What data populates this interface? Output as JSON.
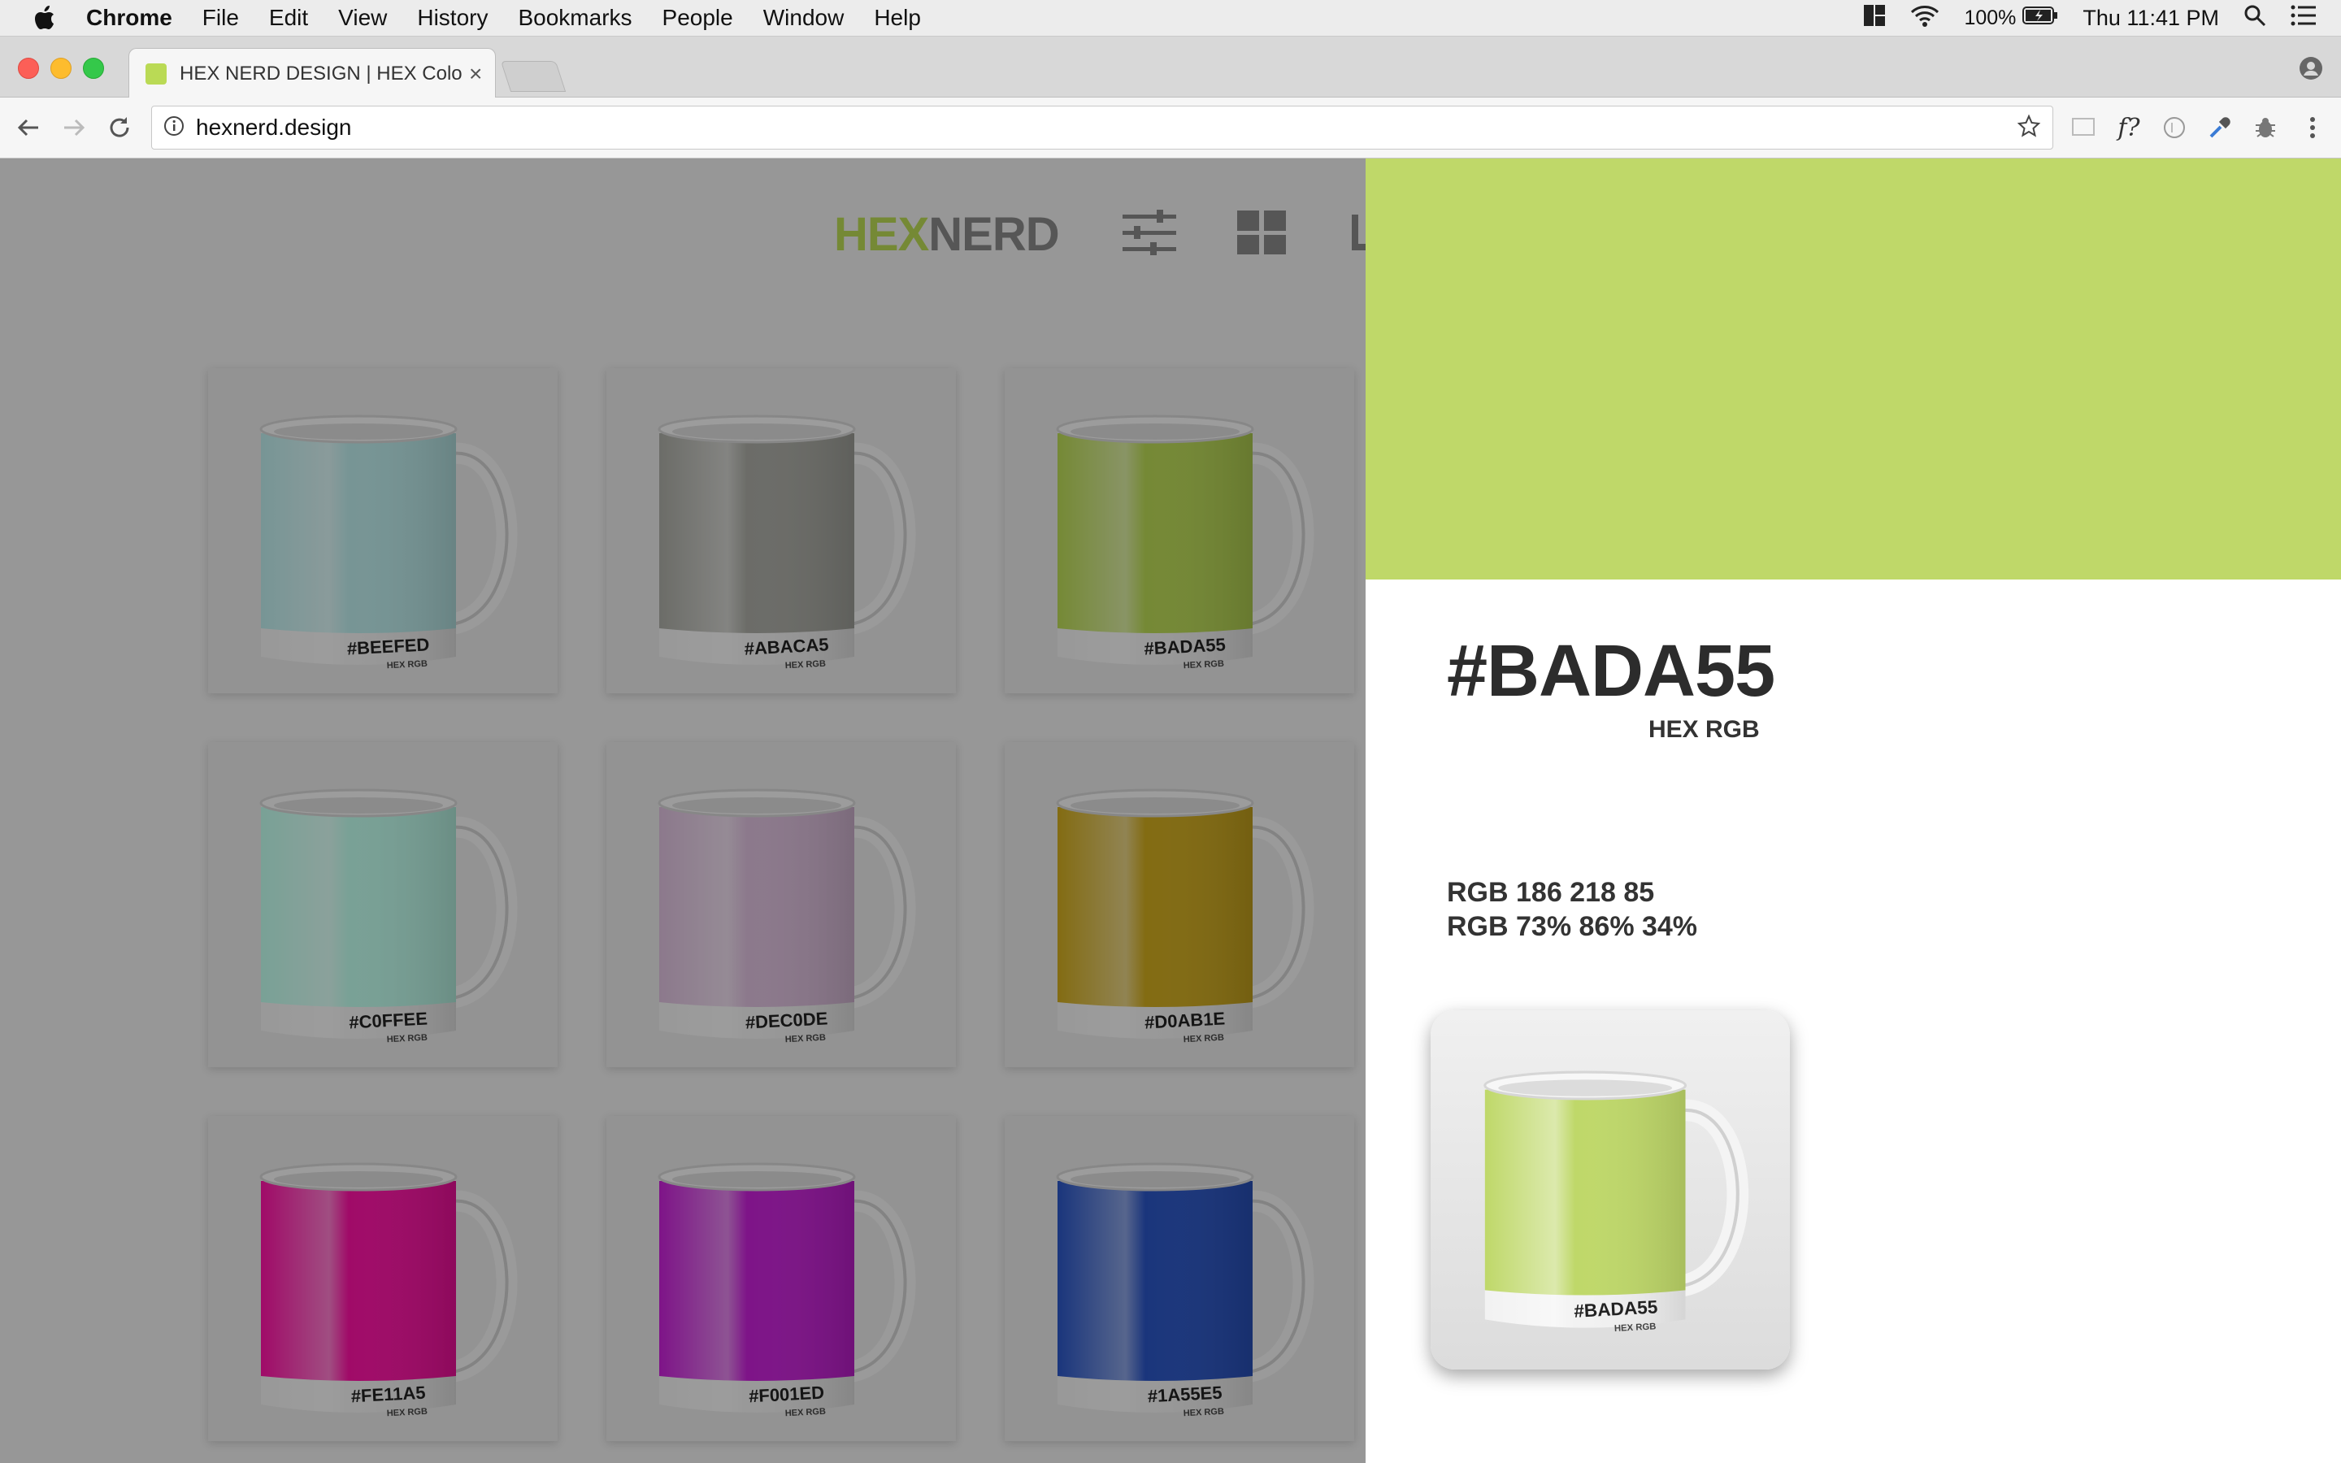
{
  "menubar": {
    "app_name": "Chrome",
    "items": [
      "File",
      "Edit",
      "View",
      "History",
      "Bookmarks",
      "People",
      "Window",
      "Help"
    ],
    "battery": "100%",
    "clock": "Thu 11:41 PM"
  },
  "tab": {
    "title": "HEX NERD DESIGN | HEX Colo",
    "close": "×",
    "favicon_color": "#bada55"
  },
  "toolbar": {
    "url": "hexnerd.design",
    "ext_font_label": "f?"
  },
  "site": {
    "logo_hex": "HEX",
    "logo_nerd": "NERD",
    "mugs": [
      {
        "code": "#BEEFED",
        "sub": "HEX RGB",
        "color": "#bdeded"
      },
      {
        "code": "#ABACA5",
        "sub": "HEX RGB",
        "color": "#abaca5"
      },
      {
        "code": "#BADA55",
        "sub": "HEX RGB",
        "color": "#bada55"
      },
      {
        "code": "#C0FFEE",
        "sub": "HEX RGB",
        "color": "#c0ffee"
      },
      {
        "code": "#DEC0DE",
        "sub": "HEX RGB",
        "color": "#dec0de"
      },
      {
        "code": "#D0AB1E",
        "sub": "HEX RGB",
        "color": "#d0ab1e"
      },
      {
        "code": "#FE11A5",
        "sub": "HEX RGB",
        "color": "#fe11a5"
      },
      {
        "code": "#F001ED",
        "sub": "HEX RGB",
        "color": "#c820d8"
      },
      {
        "code": "#1A55E5",
        "sub": "HEX RGB",
        "color": "#2a55c5"
      }
    ]
  },
  "detail": {
    "hex": "#BADA55",
    "hex_sub": "HEX RGB",
    "rgb_values": "RGB 186 218 85",
    "rgb_percent": "RGB 73% 86% 34%",
    "swatch_color": "#bfd869",
    "mug_code": "#BADA55",
    "mug_sub": "HEX RGB"
  }
}
